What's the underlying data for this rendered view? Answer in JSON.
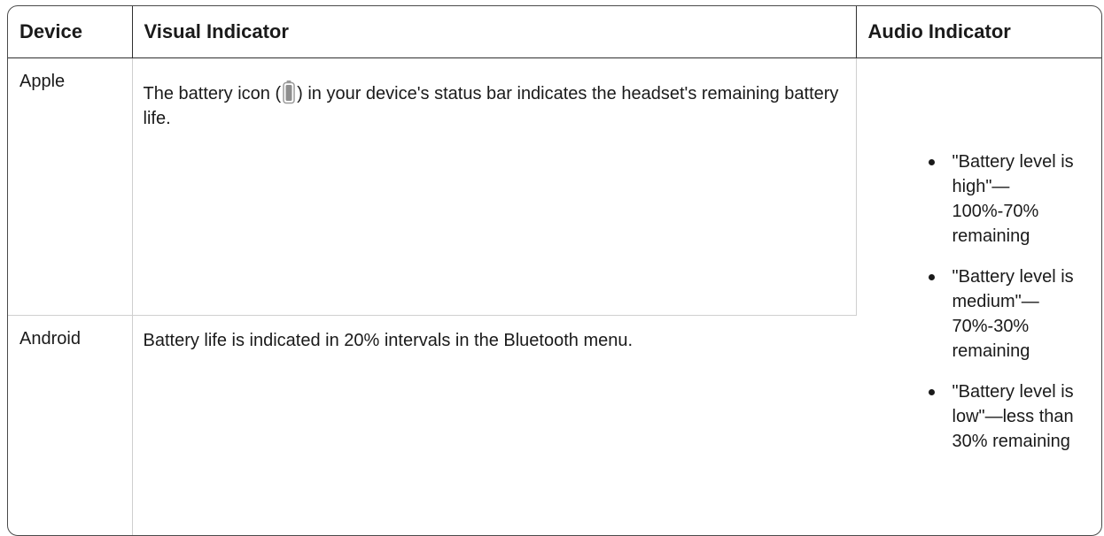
{
  "headers": {
    "device": "Device",
    "visual": "Visual Indicator",
    "audio": "Audio Indicator"
  },
  "rows": [
    {
      "device": "Apple",
      "visual_before_icon": "The battery icon (",
      "visual_icon": "battery-icon",
      "visual_after_icon": ") in your device's status bar indicates the headset's remaining battery life."
    },
    {
      "device": "Android",
      "visual": "Battery life is indicated in 20% intervals in the Bluetooth menu."
    }
  ],
  "audio_indicators": [
    "\"Battery level is high\"—100%-70% remaining",
    "\"Battery level is medium\"—70%-30% remaining",
    "\"Battery level is low\"—less than 30% remaining"
  ]
}
